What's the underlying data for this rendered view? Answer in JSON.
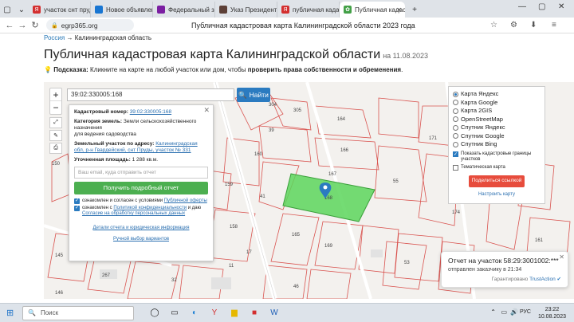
{
  "browser": {
    "tabs": [
      {
        "label": "участок снт пруды",
        "fav": "#d32f2f",
        "glyph": "Я"
      },
      {
        "label": "Новое объявление",
        "fav": "#1976d2",
        "glyph": "■"
      },
      {
        "label": "Федеральный закон",
        "fav": "#7b1fa2",
        "glyph": "■"
      },
      {
        "label": "Указ Президента РФ",
        "fav": "#5d4037",
        "glyph": "■"
      },
      {
        "label": "публичная кадастр",
        "fav": "#d32f2f",
        "glyph": "Я"
      },
      {
        "label": "Публичная кадастр",
        "fav": "#43a047",
        "glyph": "✿"
      }
    ],
    "url": "egrp365.org",
    "page_title": "Публичная кадастровая карта Калининградской области 2023 года"
  },
  "breadcrumb": {
    "root": "Россия",
    "arrow": "→",
    "current": "Калининградская область"
  },
  "heading": {
    "title": "Публичная кадастровая карта Калининградской области",
    "date": "на 11.08.2023"
  },
  "hint": {
    "prefix": "Подсказка:",
    "text": " Кликните на карте на любой участок или дом, чтобы ",
    "bold": "проверить права собственности и обременения",
    "suffix": "."
  },
  "search": {
    "value": "39:02:330005:168",
    "button": "Найти"
  },
  "popup": {
    "cad_label": "Кадастровый номер:",
    "cad_value": "39:02:330005:168",
    "cat_label": "Категория земель:",
    "cat_value": "Земли сельскохозяйственного назначения",
    "use_value": "для ведения садоводства",
    "addr_label": "Земельный участок по адресу:",
    "addr_value": "Калининградская обл, р-н Гвардейский, снт Пруды, участок № 331",
    "area_label": "Уточненная площадь:",
    "area_value": "1 288 кв.м.",
    "email_placeholder": "Ваш email, куда отправить отчет",
    "button": "Получить подробный отчет",
    "chk1_text": "ознакомлен и согласен с условиями ",
    "chk1_link": "Публичной оферты",
    "chk2_text": "ознакомлен с ",
    "chk2_link": "Политикой конфиденциальности",
    "chk2_text2": " и даю ",
    "chk2_link2": "Согласие на обработку персональных данных",
    "link1": "Детали отчета и юридическая информация",
    "link2": "Ручной выбор вариантов"
  },
  "layers": {
    "options": [
      "Карта Яндекс",
      "Карта Google",
      "Карта 2GIS",
      "OpenStreetMap",
      "Спутник Яндекс",
      "Спутник Google",
      "Спутник Bing"
    ],
    "selected": 0,
    "chk_cadastral": "Показать кадастровые границы участков",
    "chk_thematic": "Тематическая карта",
    "share": "Поделиться ссылкой",
    "settings": "Настроить карту"
  },
  "map_labels": [
    "304",
    "305",
    "164",
    "39",
    "166",
    "160",
    "167",
    "55",
    "41",
    "171",
    "159",
    "158",
    "168",
    "165",
    "169",
    "145",
    "146",
    "267",
    "53",
    "46",
    "17",
    "54",
    "28",
    "32",
    "11",
    "174",
    "161",
    "150"
  ],
  "notification": {
    "title": "Отчет на участок 58:29:3001002:***",
    "subtitle": "отправлен заказчику в 21:34",
    "guarantee": "Гарантировано",
    "brand": "TrustAction"
  },
  "taskbar": {
    "search": "Поиск",
    "lang": "РУС",
    "time": "23:22",
    "date": "10.08.2023"
  },
  "colors": {
    "parcel": "#5cd65c",
    "accent": "#2b7bc0",
    "button_green": "#4caf50",
    "share_red": "#e74c3c"
  }
}
